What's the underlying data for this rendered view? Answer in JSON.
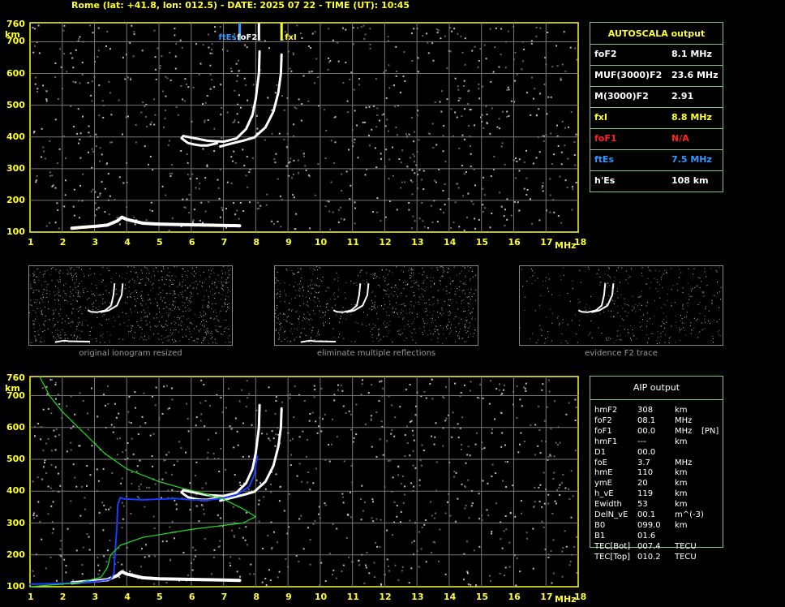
{
  "header": "Rome (lat: +41.8, lon: 012.5) - DATE: 2025 07 22 - TIME (UT): 10:45",
  "axis": {
    "y_unit": "km",
    "x_unit": "MHz",
    "y_ticks": [
      "760",
      "700",
      "600",
      "500",
      "400",
      "300",
      "200",
      "100"
    ],
    "x_ticks": [
      "1",
      "2",
      "3",
      "4",
      "5",
      "6",
      "7",
      "8",
      "9",
      "10",
      "11",
      "12",
      "13",
      "14",
      "15",
      "16",
      "17",
      "18"
    ]
  },
  "markers": [
    {
      "label": "ftEs",
      "freq": 7.5,
      "color": "#3399ff"
    },
    {
      "label": "foF2",
      "freq": 8.1,
      "color": "#ffffff"
    },
    {
      "label": "fxI",
      "freq": 8.8,
      "color": "#ffff33"
    }
  ],
  "autoscala": {
    "title": "AUTOSCALA output",
    "rows": [
      {
        "name": "foF2",
        "value": "8.1 MHz",
        "color": "#ffffff"
      },
      {
        "name": "MUF(3000)F2",
        "value": "23.6 MHz",
        "color": "#ffffff"
      },
      {
        "name": "M(3000)F2",
        "value": "2.91",
        "color": "#ffffff"
      },
      {
        "name": "fxI",
        "value": "8.8 MHz",
        "color": "#ffff33"
      },
      {
        "name": "foF1",
        "value": "N/A",
        "color": "#ff2222"
      },
      {
        "name": "ftEs",
        "value": "7.5 MHz",
        "color": "#3399ff"
      },
      {
        "name": "h'Es",
        "value": "108    km",
        "color": "#ffffff"
      }
    ]
  },
  "thumbs": [
    {
      "caption": "original ionogram resized"
    },
    {
      "caption": "eliminate multiple reflections"
    },
    {
      "caption": "evidence F2 trace"
    }
  ],
  "aip": {
    "title": "AIP output",
    "rows": [
      {
        "name": "hmF2",
        "value": "308",
        "unit": "km",
        "extra": ""
      },
      {
        "name": "foF2",
        "value": "08.1",
        "unit": "MHz",
        "extra": ""
      },
      {
        "name": "foF1",
        "value": "00.0",
        "unit": "MHz",
        "extra": "[PN]"
      },
      {
        "name": "hmF1",
        "value": "---",
        "unit": "km",
        "extra": ""
      },
      {
        "name": "D1",
        "value": "00.0",
        "unit": "",
        "extra": ""
      },
      {
        "name": "foE",
        "value": "3.7",
        "unit": "MHz",
        "extra": ""
      },
      {
        "name": "hmE",
        "value": "110",
        "unit": "km",
        "extra": ""
      },
      {
        "name": "ymE",
        "value": "20",
        "unit": "km",
        "extra": ""
      },
      {
        "name": "h_vE",
        "value": "119",
        "unit": "km",
        "extra": ""
      },
      {
        "name": "Ewidth",
        "value": "53",
        "unit": "km",
        "extra": ""
      },
      {
        "name": "DelN_vE",
        "value": "00.1",
        "unit": "m^(-3)",
        "extra": ""
      },
      {
        "name": "B0",
        "value": "099.0",
        "unit": "km",
        "extra": ""
      },
      {
        "name": "B1",
        "value": "01.6",
        "unit": "",
        "extra": ""
      },
      {
        "name": "TEC[Bot]",
        "value": "007.4",
        "unit": "TECU",
        "extra": ""
      },
      {
        "name": "TEC[Top]",
        "value": "010.2",
        "unit": "TECU",
        "extra": ""
      }
    ]
  },
  "chart_data": [
    {
      "type": "scatter",
      "xlim": [
        1,
        18
      ],
      "ylim": [
        100,
        760
      ],
      "grid": true,
      "series": [
        {
          "values": [
            [
              2.3,
              112
            ],
            [
              2.6,
              115
            ],
            [
              3.0,
              118
            ],
            [
              3.4,
              122
            ],
            [
              3.7,
              135
            ],
            [
              3.85,
              147
            ],
            [
              4.0,
              140
            ],
            [
              4.5,
              128
            ],
            [
              5.0,
              125
            ],
            [
              5.5,
              124
            ],
            [
              6.0,
              123
            ],
            [
              6.5,
              122
            ],
            [
              7.0,
              121
            ],
            [
              7.5,
              120
            ]
          ]
        },
        {
          "values": [
            [
              6.8,
              380
            ],
            [
              6.5,
              373
            ],
            [
              6.3,
              373
            ],
            [
              6.1,
              376
            ],
            [
              5.9,
              381
            ],
            [
              5.8,
              388
            ],
            [
              5.7,
              396
            ],
            [
              5.75,
              403
            ],
            [
              6.0,
              398
            ],
            [
              6.5,
              388
            ],
            [
              7.0,
              385
            ],
            [
              7.4,
              395
            ],
            [
              7.7,
              425
            ],
            [
              7.9,
              470
            ],
            [
              8.0,
              520
            ],
            [
              8.05,
              560
            ],
            [
              8.1,
              600
            ],
            [
              8.12,
              670
            ]
          ]
        },
        {
          "values": [
            [
              6.9,
              370
            ],
            [
              7.2,
              378
            ],
            [
              7.6,
              388
            ],
            [
              7.95,
              398
            ],
            [
              8.3,
              430
            ],
            [
              8.55,
              480
            ],
            [
              8.7,
              540
            ],
            [
              8.78,
              600
            ],
            [
              8.8,
              660
            ]
          ]
        }
      ]
    },
    {
      "type": "line",
      "xlim": [
        1,
        18
      ],
      "ylim": [
        100,
        760
      ],
      "grid": true,
      "series": [
        {
          "values": [
            [
              2.3,
              112
            ],
            [
              2.6,
              115
            ],
            [
              3.0,
              118
            ],
            [
              3.4,
              122
            ],
            [
              3.7,
              135
            ],
            [
              3.85,
              147
            ],
            [
              4.0,
              140
            ],
            [
              4.5,
              128
            ],
            [
              5.0,
              125
            ],
            [
              5.5,
              124
            ],
            [
              6.0,
              123
            ],
            [
              6.5,
              122
            ],
            [
              7.0,
              121
            ],
            [
              7.5,
              120
            ]
          ]
        },
        {
          "values": [
            [
              6.8,
              380
            ],
            [
              6.5,
              373
            ],
            [
              6.3,
              373
            ],
            [
              6.1,
              376
            ],
            [
              5.9,
              381
            ],
            [
              5.8,
              388
            ],
            [
              5.7,
              396
            ],
            [
              5.75,
              403
            ],
            [
              6.0,
              398
            ],
            [
              6.5,
              388
            ],
            [
              7.0,
              385
            ],
            [
              7.4,
              395
            ],
            [
              7.7,
              425
            ],
            [
              7.9,
              470
            ],
            [
              8.0,
              520
            ],
            [
              8.05,
              560
            ],
            [
              8.1,
              600
            ],
            [
              8.12,
              670
            ]
          ]
        },
        {
          "values": [
            [
              6.9,
              370
            ],
            [
              7.2,
              378
            ],
            [
              7.6,
              388
            ],
            [
              7.95,
              398
            ],
            [
              8.3,
              430
            ],
            [
              8.55,
              480
            ],
            [
              8.7,
              540
            ],
            [
              8.78,
              600
            ],
            [
              8.8,
              660
            ]
          ]
        },
        {
          "values": [
            [
              1.0,
              108
            ],
            [
              1.8,
              110
            ],
            [
              2.5,
              112
            ],
            [
              3.0,
              116
            ],
            [
              3.3,
              120
            ],
            [
              3.5,
              124
            ],
            [
              3.6,
              140
            ],
            [
              3.62,
              180
            ],
            [
              3.7,
              300
            ],
            [
              3.72,
              358
            ],
            [
              3.8,
              380
            ],
            [
              3.9,
              376
            ],
            [
              4.5,
              373
            ],
            [
              5.5,
              377
            ],
            [
              6.0,
              373
            ],
            [
              6.5,
              372
            ],
            [
              7.0,
              378
            ],
            [
              7.4,
              388
            ],
            [
              7.8,
              415
            ],
            [
              7.95,
              450
            ],
            [
              8.0,
              480
            ],
            [
              8.05,
              510
            ]
          ]
        },
        {
          "values": [
            [
              1.3,
              760
            ],
            [
              1.6,
              700
            ],
            [
              2.0,
              650
            ],
            [
              2.6,
              590
            ],
            [
              3.3,
              520
            ],
            [
              4.0,
              470
            ],
            [
              5.0,
              430
            ],
            [
              5.7,
              410
            ],
            [
              6.3,
              395
            ],
            [
              7.0,
              375
            ],
            [
              7.6,
              345
            ],
            [
              8.0,
              320
            ],
            [
              7.6,
              300
            ],
            [
              6.0,
              280
            ],
            [
              4.5,
              255
            ],
            [
              3.8,
              230
            ],
            [
              3.5,
              200
            ],
            [
              3.4,
              160
            ],
            [
              3.2,
              130
            ],
            [
              2.5,
              112
            ],
            [
              1.5,
              104
            ],
            [
              1.0,
              100
            ]
          ]
        }
      ]
    }
  ]
}
